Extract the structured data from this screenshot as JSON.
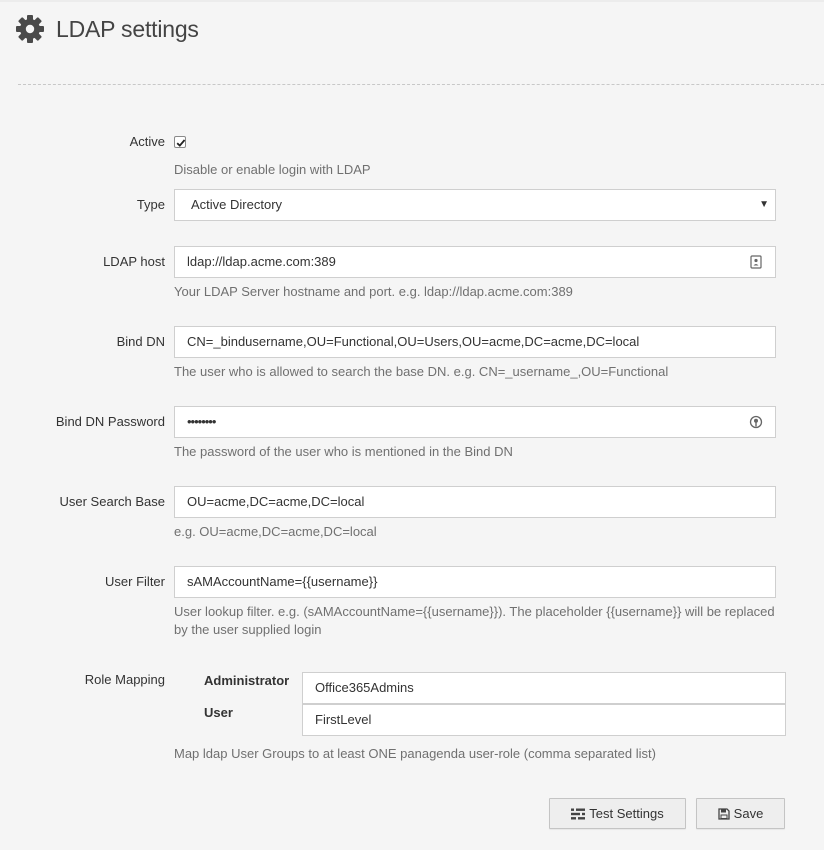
{
  "header": {
    "title": "LDAP settings",
    "icon": "gear-icon"
  },
  "form": {
    "active": {
      "label": "Active",
      "checked": true,
      "help": "Disable or enable login with LDAP"
    },
    "type": {
      "label": "Type",
      "value": "Active Directory"
    },
    "ldap_host": {
      "label": "LDAP host",
      "value": "ldap://ldap.acme.com:389",
      "help": "Your LDAP Server hostname and port. e.g. ldap://ldap.acme.com:389"
    },
    "bind_dn": {
      "label": "Bind DN",
      "value": "CN=_bindusername,OU=Functional,OU=Users,OU=acme,DC=acme,DC=local",
      "help": "The user who is allowed to search the base DN. e.g. CN=_username_,OU=Functional"
    },
    "bind_password": {
      "label": "Bind DN Password",
      "value": "••••••••",
      "help": "The password of the user who is mentioned in the Bind DN"
    },
    "user_search_base": {
      "label": "User Search Base",
      "value": "OU=acme,DC=acme,DC=local",
      "help": "e.g. OU=acme,DC=acme,DC=local"
    },
    "user_filter": {
      "label": "User Filter",
      "value": "sAMAccountName={{username}}",
      "help_line1": "User lookup filter. e.g. (sAMAccountName={{username}}). The placeholder {{username}} will be replaced",
      "help_line2": "by the user supplied login"
    },
    "role_mapping": {
      "label": "Role Mapping",
      "roles": [
        {
          "name": "Administrator",
          "value": "Office365Admins"
        },
        {
          "name": "User",
          "value": "FirstLevel"
        }
      ],
      "help": "Map ldap User Groups to at least ONE panagenda user-role (comma separated list)"
    }
  },
  "buttons": {
    "test_label": "Test Settings",
    "save_label": "Save"
  }
}
